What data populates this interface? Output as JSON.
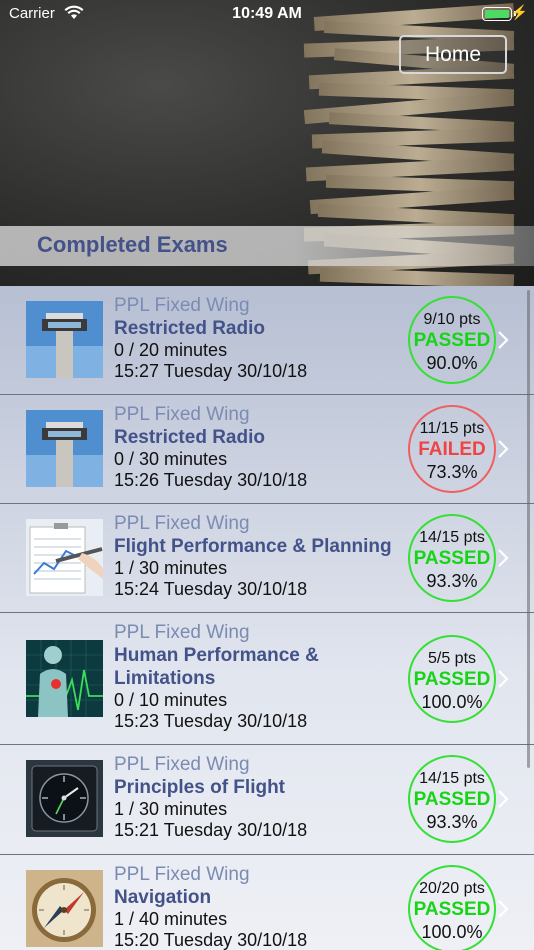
{
  "status_bar": {
    "carrier": "Carrier",
    "time": "10:49 AM"
  },
  "header": {
    "home_label": "Home",
    "section_title": "Completed Exams"
  },
  "colors": {
    "passed": "#16d516",
    "failed": "#ee4444",
    "subject": "#44528a",
    "course": "#7b8bb2"
  },
  "exams": [
    {
      "course": "PPL Fixed Wing",
      "subject": "Restricted Radio",
      "duration": "0 / 20 minutes",
      "datetime": "15:27 Tuesday 30/10/18",
      "points": "9/10 pts",
      "result": "PASSED",
      "percent": "90.0%",
      "icon": "control-tower-icon"
    },
    {
      "course": "PPL Fixed Wing",
      "subject": "Restricted Radio",
      "duration": "0 / 30 minutes",
      "datetime": "15:26 Tuesday 30/10/18",
      "points": "11/15 pts",
      "result": "FAILED",
      "percent": "73.3%",
      "icon": "control-tower-icon"
    },
    {
      "course": "PPL Fixed Wing",
      "subject": "Flight Performance & Planning",
      "duration": "1 / 30 minutes",
      "datetime": "15:24 Tuesday 30/10/18",
      "points": "14/15 pts",
      "result": "PASSED",
      "percent": "93.3%",
      "icon": "clipboard-pen-icon"
    },
    {
      "course": "PPL Fixed Wing",
      "subject": "Human Performance & Limitations",
      "duration": "0 / 10 minutes",
      "datetime": "15:23 Tuesday 30/10/18",
      "points": "5/5 pts",
      "result": "PASSED",
      "percent": "100.0%",
      "icon": "human-heart-icon"
    },
    {
      "course": "PPL Fixed Wing",
      "subject": "Principles of Flight",
      "duration": "1 / 30 minutes",
      "datetime": "15:21 Tuesday 30/10/18",
      "points": "14/15 pts",
      "result": "PASSED",
      "percent": "93.3%",
      "icon": "cockpit-instrument-icon"
    },
    {
      "course": "PPL Fixed Wing",
      "subject": "Navigation",
      "duration": "1 / 40 minutes",
      "datetime": "15:20 Tuesday 30/10/18",
      "points": "20/20 pts",
      "result": "PASSED",
      "percent": "100.0%",
      "icon": "compass-icon"
    }
  ]
}
